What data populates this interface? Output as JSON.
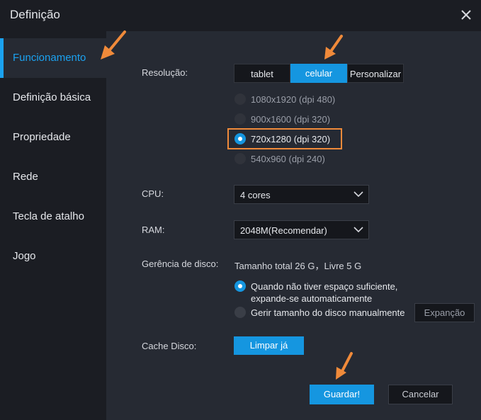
{
  "window": {
    "title": "Definição"
  },
  "sidebar": {
    "items": [
      {
        "label": "Funcionamento",
        "active": true
      },
      {
        "label": "Definição básica"
      },
      {
        "label": "Propriedade"
      },
      {
        "label": "Rede"
      },
      {
        "label": "Tecla de atalho"
      },
      {
        "label": "Jogo"
      }
    ]
  },
  "resolution": {
    "label": "Resolução:",
    "tabs": [
      "tablet",
      "celular",
      "Personalizar"
    ],
    "selected_tab": "celular",
    "options": [
      "1080x1920  (dpi 480)",
      "900x1600  (dpi 320)",
      "720x1280  (dpi 320)",
      "540x960  (dpi 240)"
    ],
    "selected_option": "720x1280  (dpi 320)"
  },
  "cpu": {
    "label": "CPU:",
    "value": "4 cores"
  },
  "ram": {
    "label": "RAM:",
    "value": "2048M(Recomendar)"
  },
  "disk": {
    "label": "Gerência de disco:",
    "info": "Tamanho total 26 G，Livre 5 G",
    "option_auto_line1": "Quando não tiver espaço suficiente,",
    "option_auto_line2": "expande-se automaticamente",
    "option_manual": "Gerir tamanho do disco manualmente",
    "expand_button": "Expanção"
  },
  "cache": {
    "label": "Cache Disco:",
    "button": "Limpar já"
  },
  "footer": {
    "save": "Guardar!",
    "cancel": "Cancelar"
  },
  "colors": {
    "accent": "#1596e0",
    "annotation": "#f08a3a",
    "panel": "#262a33",
    "sidebar": "#1b1d23"
  }
}
